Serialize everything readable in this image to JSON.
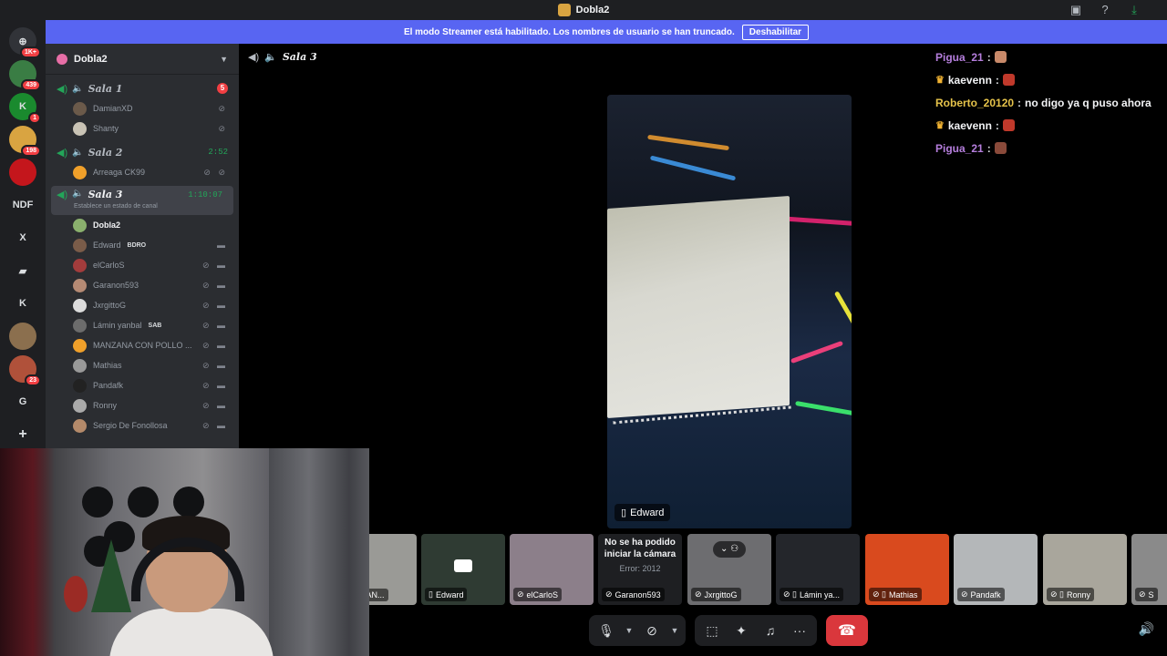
{
  "titlebar": {
    "title": "Dobla2"
  },
  "banner": {
    "text": "El modo Streamer está habilitado. Los nombres de usuario se han truncado.",
    "button": "Deshabilitar"
  },
  "rail": [
    {
      "name": "discord-home",
      "badge": "1K+",
      "color": "#313338",
      "glyph": "⊕"
    },
    {
      "name": "server-1",
      "badge": "439",
      "color": "#3a7d44",
      "glyph": ""
    },
    {
      "name": "server-2",
      "badge": "1",
      "color": "#1a8a2e",
      "glyph": "K"
    },
    {
      "name": "server-3",
      "badge": "198",
      "color": "#d9a441",
      "glyph": ""
    },
    {
      "name": "server-4",
      "badge": "",
      "color": "#c4161c",
      "glyph": ""
    },
    {
      "name": "server-ndf",
      "badge": "",
      "color": "",
      "glyph": "NDF"
    },
    {
      "name": "server-x",
      "badge": "",
      "color": "",
      "glyph": "X"
    },
    {
      "name": "server-folder",
      "badge": "",
      "color": "",
      "glyph": "▰"
    },
    {
      "name": "server-k",
      "badge": "",
      "color": "",
      "glyph": "K"
    },
    {
      "name": "server-5",
      "badge": "",
      "color": "#8b6f4e",
      "glyph": ""
    },
    {
      "name": "server-6",
      "badge": "23",
      "color": "#b0513a",
      "glyph": ""
    },
    {
      "name": "server-g",
      "badge": "",
      "color": "",
      "glyph": "G"
    },
    {
      "name": "add-server",
      "badge": "",
      "color": "",
      "glyph": "+"
    }
  ],
  "sidebar": {
    "server_name": "Dobla2",
    "channels": [
      {
        "name": "Sala 1",
        "right": "5",
        "right_type": "badge",
        "users": [
          {
            "name": "DamianXD",
            "tag": "",
            "icons": "⊘"
          },
          {
            "name": "Shanty",
            "tag": "",
            "icons": "⊘"
          }
        ]
      },
      {
        "name": "Sala 2",
        "right": "2:52",
        "right_type": "time",
        "users": [
          {
            "name": "Arreaga CK99",
            "tag": "",
            "icons": "⊘ ⊘"
          }
        ]
      },
      {
        "name": "Sala 3",
        "right": "1:10:07",
        "right_type": "time",
        "active": true,
        "status": "Establece un estado de canal",
        "users": [
          {
            "name": "Dobla2",
            "tag": "",
            "icons": "",
            "me": true
          },
          {
            "name": "Edward",
            "tag": "BDRO",
            "icons": "▬"
          },
          {
            "name": "elCarloS",
            "tag": "",
            "icons": "⊘ ▬"
          },
          {
            "name": "Garanon593",
            "tag": "",
            "icons": "⊘ ▬"
          },
          {
            "name": "JxrgittoG",
            "tag": "",
            "icons": "⊘ ▬"
          },
          {
            "name": "Lámin yanbal",
            "tag": "SAB",
            "icons": "⊘ ▬"
          },
          {
            "name": "MANZANA CON POLLO ...",
            "tag": "",
            "icons": "⊘ ▬"
          },
          {
            "name": "Mathias",
            "tag": "",
            "icons": "⊘ ▬"
          },
          {
            "name": "Pandafk",
            "tag": "",
            "icons": "⊘ ▬"
          },
          {
            "name": "Ronny",
            "tag": "",
            "icons": "⊘ ▬"
          },
          {
            "name": "Sergio De Fonollosa",
            "tag": "",
            "icons": "⊘ ▬"
          }
        ]
      }
    ]
  },
  "call": {
    "channel": "Sala 3",
    "main_video_label": "Edward"
  },
  "chat": [
    {
      "user": "Pigua_21",
      "color": "#b57edc",
      "crown": false,
      "text": "",
      "emote_color": "#c98a6a"
    },
    {
      "user": "kaevenn",
      "color": "#f2f3f5",
      "crown": true,
      "text": "",
      "emote_color": "#c0392b"
    },
    {
      "user": "Roberto_20120",
      "color": "#e6c34a",
      "crown": false,
      "text": "no digo ya q puso ahora",
      "emote_color": ""
    },
    {
      "user": "kaevenn",
      "color": "#f2f3f5",
      "crown": true,
      "text": "",
      "emote_color": "#c0392b"
    },
    {
      "user": "Pigua_21",
      "color": "#b57edc",
      "crown": false,
      "text": "",
      "emote_color": "#8a4a3a"
    }
  ],
  "tiles": [
    {
      "label": "MANZAN...",
      "bg": "#9a9a96",
      "icon": ""
    },
    {
      "label": "Edward",
      "bg": "#2f3b33",
      "icon": "▯",
      "cam": true
    },
    {
      "label": "elCarloS",
      "bg": "#8c7f8a",
      "icon": "⊘"
    },
    {
      "label": "Garanon593",
      "bg": "#1e1f22",
      "icon": "⊘",
      "error_title": "No se ha podido iniciar la cámara",
      "error_code": "Error: 2012"
    },
    {
      "label": "JxrgittoG",
      "bg": "#6d6d70",
      "icon": "⊘",
      "group": true
    },
    {
      "label": "Lámin ya...",
      "bg": "#24262b",
      "icon": "⊘ ▯"
    },
    {
      "label": "Mathias",
      "bg": "#d94a1e",
      "icon": "⊘ ▯"
    },
    {
      "label": "Pandafk",
      "bg": "#b4b7b9",
      "icon": "⊘"
    },
    {
      "label": "Ronny",
      "bg": "#a9a69c",
      "icon": "⊘ ▯"
    },
    {
      "label": "S",
      "bg": "#8a8a8a",
      "icon": "⊘"
    }
  ],
  "controls": {
    "mic": "🎙",
    "camera": "⊘",
    "screenshare": "⬚",
    "activities": "✦",
    "soundboard": "♫",
    "more": "···",
    "hangup": "☎"
  }
}
